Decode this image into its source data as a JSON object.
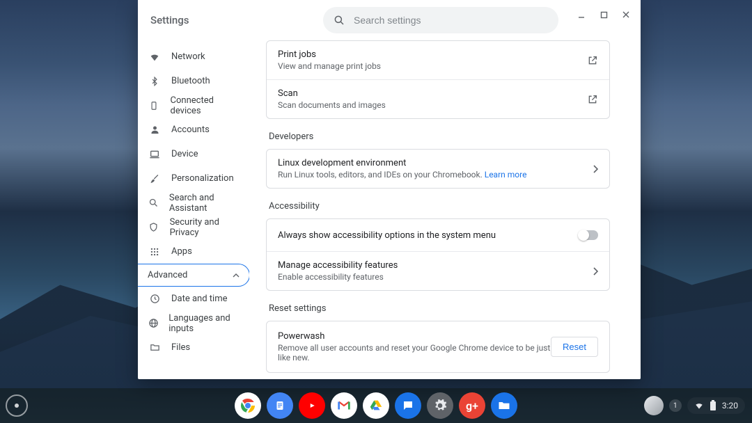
{
  "window": {
    "title": "Settings",
    "search_placeholder": "Search settings"
  },
  "sidebar": {
    "items": [
      {
        "label": "Network",
        "icon": "wifi"
      },
      {
        "label": "Bluetooth",
        "icon": "bluetooth"
      },
      {
        "label": "Connected devices",
        "icon": "phone"
      },
      {
        "label": "Accounts",
        "icon": "person"
      },
      {
        "label": "Device",
        "icon": "laptop"
      },
      {
        "label": "Personalization",
        "icon": "brush"
      },
      {
        "label": "Search and Assistant",
        "icon": "search"
      },
      {
        "label": "Security and Privacy",
        "icon": "shield"
      },
      {
        "label": "Apps",
        "icon": "grid"
      }
    ],
    "advanced_label": "Advanced",
    "sub_items": [
      {
        "label": "Date and time",
        "icon": "clock"
      },
      {
        "label": "Languages and inputs",
        "icon": "globe"
      },
      {
        "label": "Files",
        "icon": "folder"
      }
    ]
  },
  "content": {
    "print": {
      "title": "Print jobs",
      "sub": "View and manage print jobs"
    },
    "scan": {
      "title": "Scan",
      "sub": "Scan documents and images"
    },
    "developers": {
      "heading": "Developers",
      "linux_title": "Linux development environment",
      "linux_sub": "Run Linux tools, editors, and IDEs on your Chromebook. ",
      "learn_more": "Learn more"
    },
    "accessibility": {
      "heading": "Accessibility",
      "always_show": "Always show accessibility options in the system menu",
      "manage_title": "Manage accessibility features",
      "manage_sub": "Enable accessibility features"
    },
    "reset": {
      "heading": "Reset settings",
      "powerwash_title": "Powerwash",
      "powerwash_sub": "Remove all user accounts and reset your Google Chrome device to be just like new.",
      "button": "Reset"
    }
  },
  "shelf": {
    "notif_count": "1",
    "time": "3:20"
  }
}
